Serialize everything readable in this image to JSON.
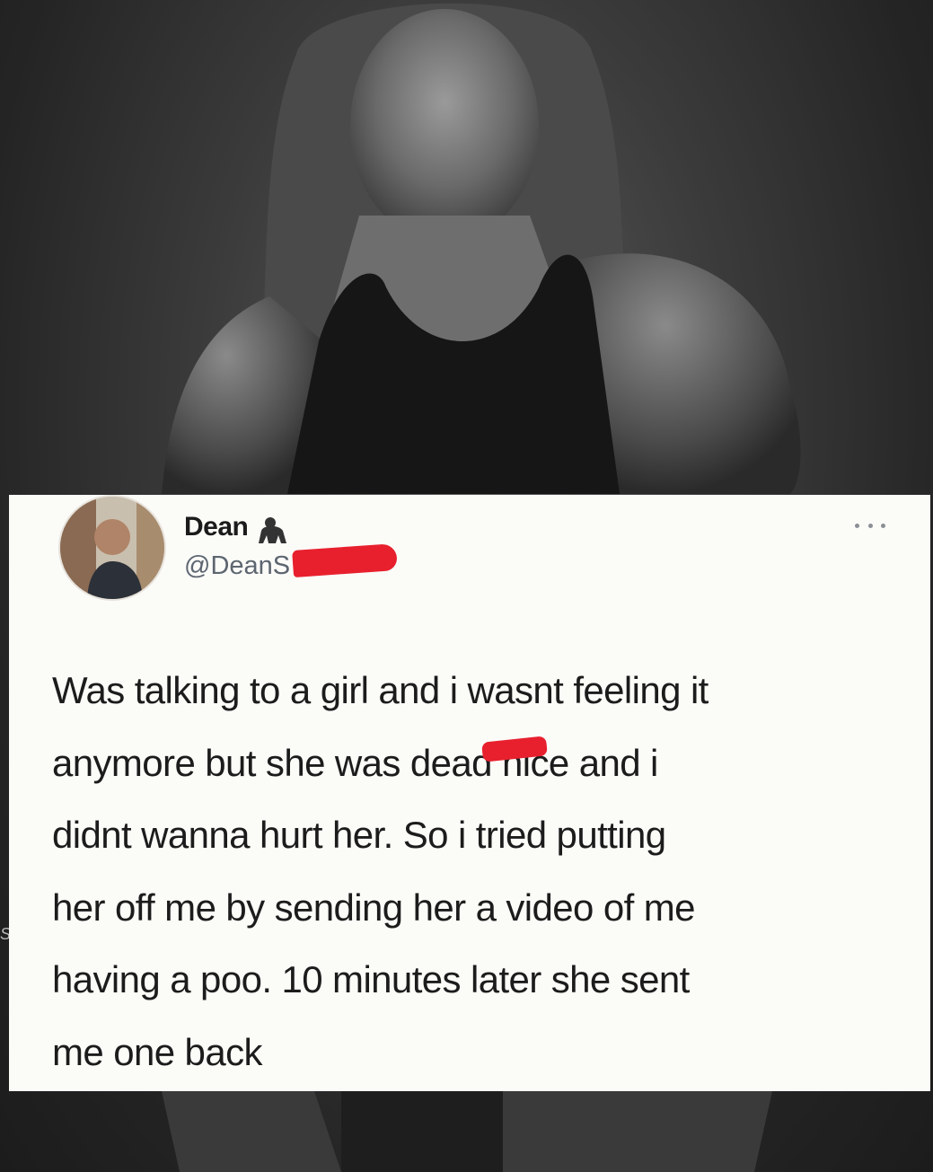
{
  "background": {
    "description_icon": "portrait-photo"
  },
  "tweet": {
    "display_name": "Dean",
    "name_badge_icon": "gorilla-icon",
    "handle": "@DeanS",
    "more_icon": "more-horizontal-icon",
    "text": "Was talking to a girl and i wasnt feeling it\nanymore but she was dead nice and i\ndidnt wanna hurt her. So i tried putting\nher off me by sending her a video of me\nhaving a poo. 10 minutes later she sent\nme one back",
    "redaction_color": "#e8202e"
  },
  "side_glyph": "S"
}
